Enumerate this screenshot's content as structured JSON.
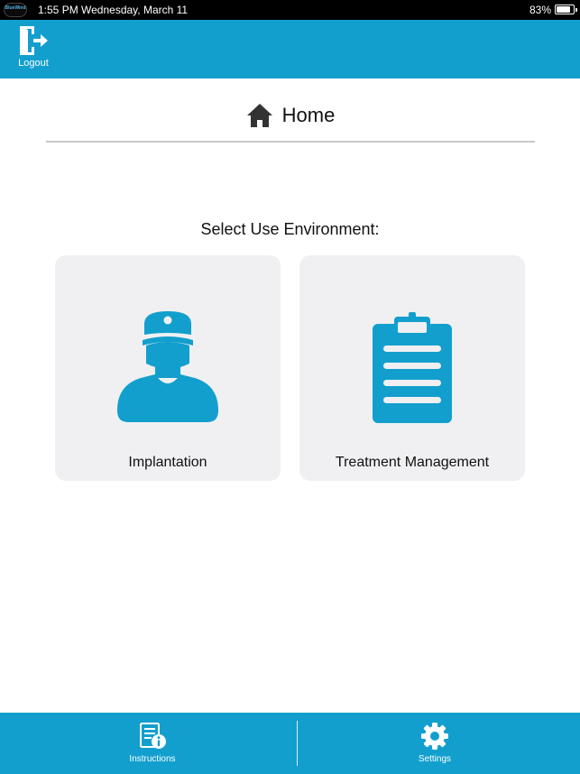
{
  "status_bar": {
    "logo_text": "BlueWind",
    "time_date": "1:55 PM Wednesday, March 11",
    "battery_percent": "83%",
    "battery_level": 0.83
  },
  "top_bar": {
    "logout_label": "Logout",
    "logout_icon": "logout-door-icon"
  },
  "header": {
    "title": "Home",
    "icon": "home-icon"
  },
  "main": {
    "prompt": "Select Use Environment:",
    "options": [
      {
        "label": "Implantation",
        "icon": "surgeon-icon"
      },
      {
        "label": "Treatment Management",
        "icon": "clipboard-icon"
      }
    ]
  },
  "bottom_nav": {
    "tabs": [
      {
        "label": "Instructions",
        "icon": "instructions-document-icon"
      },
      {
        "label": "Settings",
        "icon": "gear-icon"
      }
    ]
  },
  "colors": {
    "accent": "#129fce",
    "card_background": "#f0f0f2",
    "icon_dark": "#333333"
  }
}
